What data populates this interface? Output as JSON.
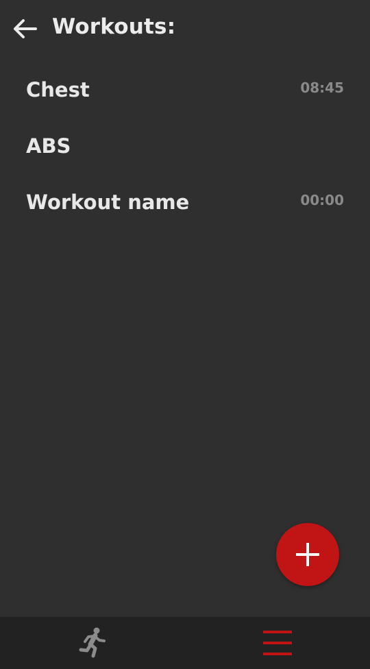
{
  "header": {
    "title": "Workouts:"
  },
  "workouts": [
    {
      "name": "Chest",
      "duration": "08:45"
    },
    {
      "name": "ABS",
      "duration": ""
    },
    {
      "name": "Workout name",
      "duration": "00:00"
    }
  ],
  "fab": {
    "icon": "plus-icon",
    "color": "#c11414"
  },
  "bottom_nav": {
    "items": [
      {
        "icon": "running-person-icon",
        "active": false
      },
      {
        "icon": "menu-lines-icon",
        "active": true
      }
    ],
    "active_color": "#c11414",
    "inactive_color": "#8c8c8c"
  },
  "colors": {
    "background": "#2f2f2f",
    "nav_background": "#222222",
    "accent": "#c11414"
  }
}
